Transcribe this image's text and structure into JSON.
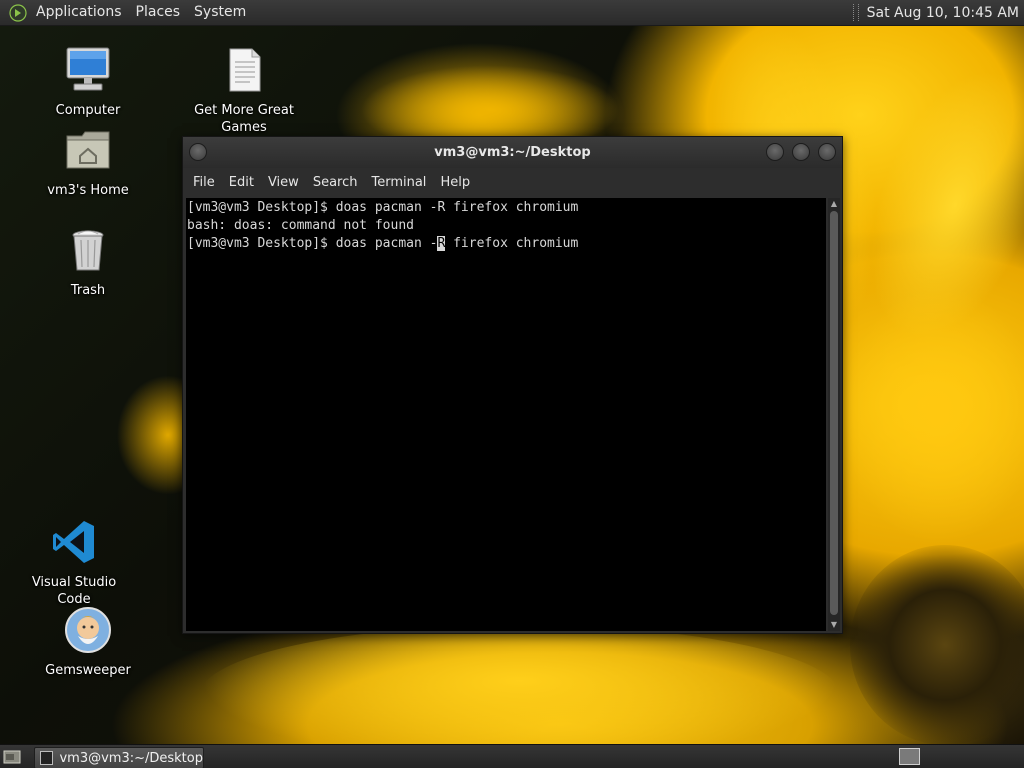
{
  "top_panel": {
    "menus": [
      "Applications",
      "Places",
      "System"
    ],
    "clock": "Sat Aug 10, 10:45 AM"
  },
  "desktop_icons": [
    {
      "label": "Computer",
      "icon": "computer-icon"
    },
    {
      "label": "Get More Great Games",
      "icon": "document-icon"
    },
    {
      "label": "vm3's Home",
      "icon": "home-folder-icon"
    },
    {
      "label": "Trash",
      "icon": "trash-icon"
    },
    {
      "label": "Visual Studio Code",
      "icon": "vscode-icon"
    },
    {
      "label": "Gemsweeper",
      "icon": "gemsweeper-icon"
    }
  ],
  "terminal": {
    "title": "vm3@vm3:~/Desktop",
    "menu": [
      "File",
      "Edit",
      "View",
      "Search",
      "Terminal",
      "Help"
    ],
    "lines": [
      "[vm3@vm3 Desktop]$ doas pacman -R firefox chromium",
      "bash: doas: command not found"
    ],
    "prompt_before_cursor": "[vm3@vm3 Desktop]$ doas pacman -",
    "cursor_char": "R",
    "prompt_after_cursor": " firefox chromium"
  },
  "bottom_panel": {
    "task_label": "vm3@vm3:~/Desktop"
  },
  "colors": {
    "terminal_bg": "#000000",
    "terminal_fg": "#d8d8d8",
    "panel_bg": "#2a2a2a",
    "vscode_blue": "#1f8ad2"
  }
}
